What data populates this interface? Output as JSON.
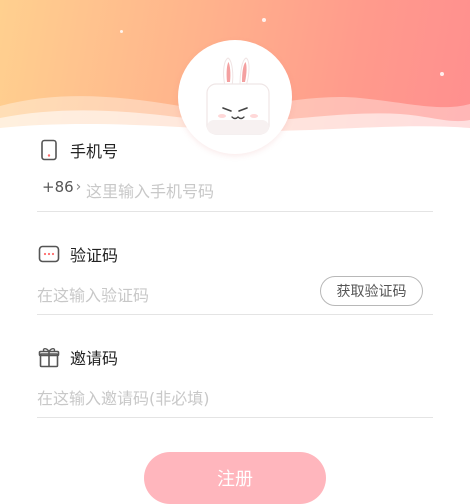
{
  "header": {
    "gradient_colors": [
      "#ffd08f",
      "#ffb48c",
      "#ff9a8c",
      "#ff8f8f"
    ],
    "mascot": "bunny-mascot"
  },
  "form": {
    "phone": {
      "icon": "phone-icon",
      "label": "手机号",
      "country_code": "+86",
      "placeholder": "这里输入手机号码"
    },
    "verification": {
      "icon": "message-icon",
      "label": "验证码",
      "placeholder": "在这输入验证码",
      "get_code_button": "获取验证码"
    },
    "invite": {
      "icon": "gift-icon",
      "label": "邀请码",
      "placeholder": "在这输入邀请码(非必填)"
    }
  },
  "submit": {
    "label": "注册",
    "color": "#ffb6bd"
  }
}
